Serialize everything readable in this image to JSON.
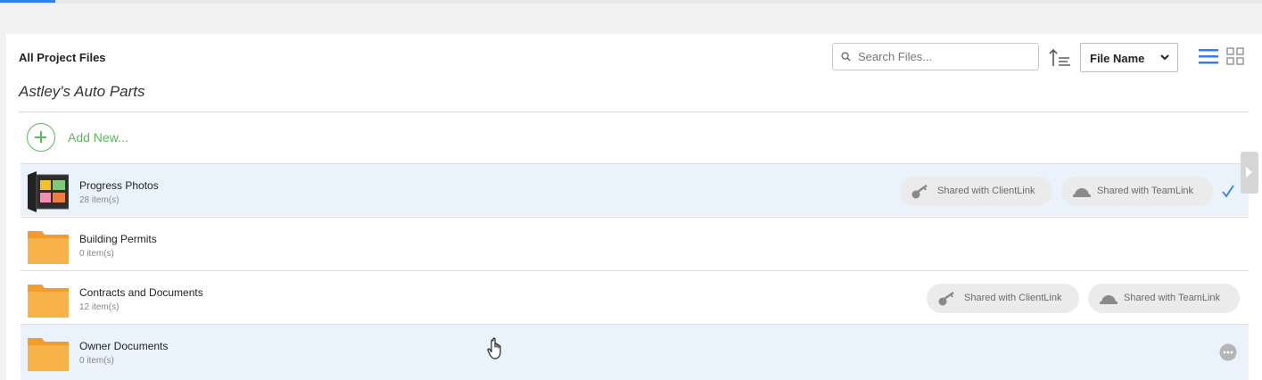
{
  "header": {
    "title": "All Project Files",
    "project_name": "Astley's Auto Parts"
  },
  "toolbar": {
    "search_placeholder": "Search Files...",
    "sort_select_value": "File Name"
  },
  "add_new_label": "Add New...",
  "items": [
    {
      "name": "Progress Photos",
      "count": "28 item(s)",
      "thumbnail": "photo-collage",
      "badges": [
        "Shared with ClientLink",
        "Shared with TeamLink"
      ],
      "selected": true
    },
    {
      "name": "Building Permits",
      "count": "0 item(s)",
      "thumbnail": "folder",
      "badges": []
    },
    {
      "name": "Contracts and Documents",
      "count": "12 item(s)",
      "thumbnail": "folder",
      "badges": [
        "Shared with ClientLink",
        "Shared with TeamLink"
      ]
    },
    {
      "name": "Owner Documents",
      "count": "0 item(s)",
      "thumbnail": "folder",
      "badges": [],
      "hovered": true
    }
  ],
  "colors": {
    "accent_blue": "#2f80ed",
    "add_green": "#5cb85c",
    "folder_orange": "#f8b24a",
    "highlight_row": "#eaf3fc"
  }
}
